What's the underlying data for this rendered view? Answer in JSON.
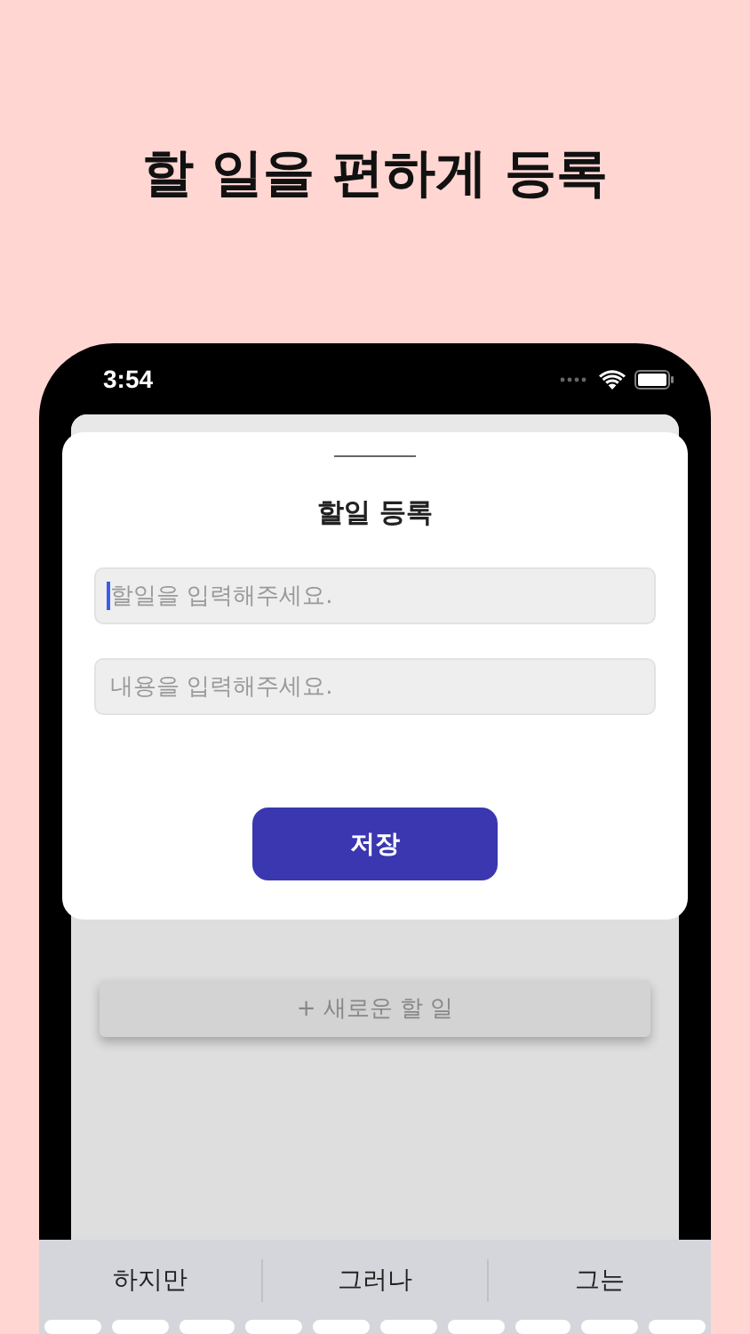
{
  "headline": "할 일을 편하게 등록",
  "status_bar": {
    "time": "3:54"
  },
  "sheet": {
    "title": "할일 등록",
    "fields": [
      {
        "placeholder": "할일을 입력해주세요.",
        "focused": true
      },
      {
        "placeholder": "내용을 입력해주세요.",
        "focused": false
      }
    ],
    "save_button": "저장"
  },
  "new_todo_button": "+ 새로운 할 일",
  "keyboard": {
    "suggestions": [
      "하지만",
      "그러나",
      "그는"
    ]
  }
}
